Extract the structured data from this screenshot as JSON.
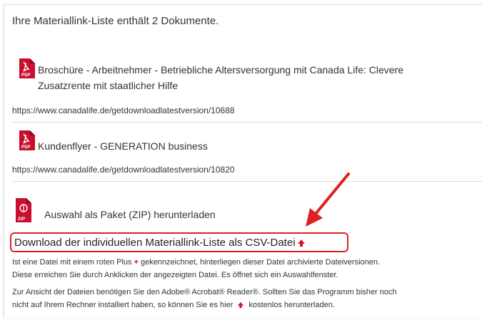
{
  "heading": "Ihre Materiallink-Liste enthält 2 Dokumente.",
  "documents": [
    {
      "title_line1": "Broschüre - Arbeitnehmer - Betriebliche Altersversorgung mit Canada Life: Clevere",
      "title_line2": "Zusatzrente mit staatlicher Hilfe",
      "url": "https://www.canadalife.de/getdownloadlatestversion/10688",
      "icon": "pdf-icon"
    },
    {
      "title_line1": "Kundenflyer - GENERATION business",
      "title_line2": "",
      "url": "https://www.canadalife.de/getdownloadlatestversion/10820",
      "icon": "pdf-icon"
    }
  ],
  "zip": {
    "label": "Auswahl als Paket (ZIP) herunterladen",
    "icon": "zip-icon"
  },
  "csv": {
    "label": "Download der individuellen Materiallink-Liste als CSV-Datei",
    "icon": "up-arrow-icon"
  },
  "info": {
    "line1_a": "Ist eine Datei mit einem roten Plus",
    "line1_plus": "+",
    "line1_b": "gekennzeichnet, hinterliegen dieser Datei archivierte Dateiversionen.",
    "line2": "Diese erreichen Sie durch Anklicken der angezeigten Datei. Es öffnet sich ein Auswahlfenster.",
    "line3": "Zur Ansicht der Dateien benötigen Sie den Adobe® Acrobat® Reader®. Sollten Sie das Programm bisher noch",
    "line4_a": "nicht auf Ihrem Rechner installiert haben, so können Sie es hier",
    "line4_b": "kostenlos herunterladen."
  },
  "colors": {
    "accent_red": "#d2142a",
    "highlight_red": "#e02020"
  }
}
